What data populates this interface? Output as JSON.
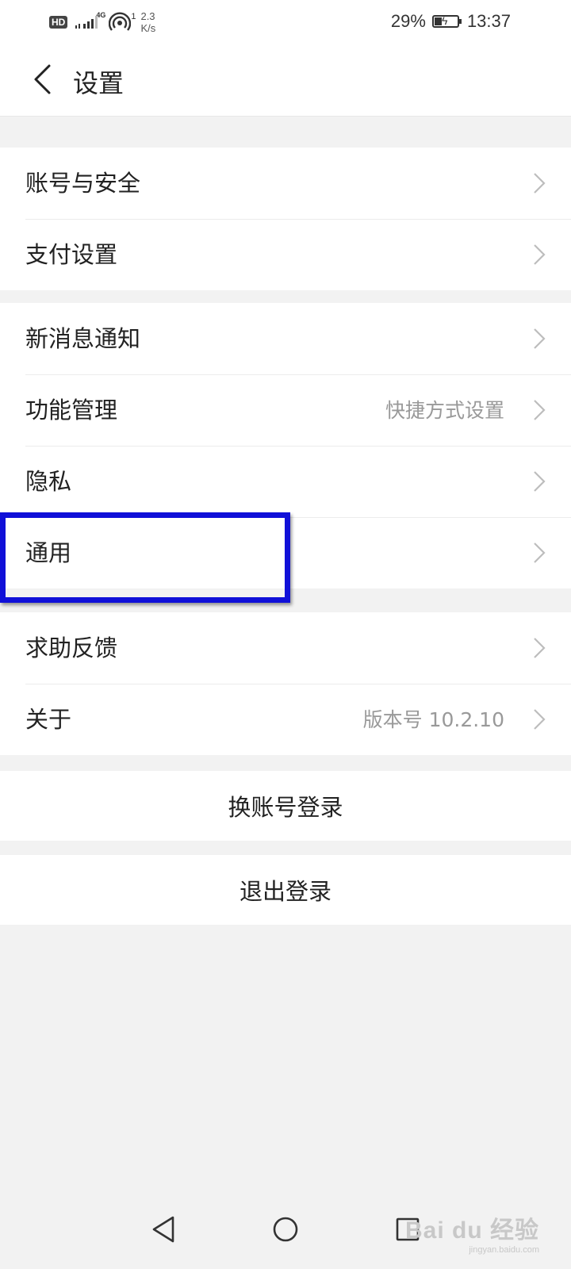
{
  "status_bar": {
    "hd": "HD",
    "network": "4G",
    "hotspot_count": "1",
    "speed_value": "2.3",
    "speed_unit": "K/s",
    "battery": "29%",
    "time": "13:37"
  },
  "header": {
    "title": "设置"
  },
  "groups": [
    {
      "items": [
        {
          "label": "账号与安全",
          "value": ""
        },
        {
          "label": "支付设置",
          "value": ""
        }
      ]
    },
    {
      "items": [
        {
          "label": "新消息通知",
          "value": ""
        },
        {
          "label": "功能管理",
          "value": "快捷方式设置"
        },
        {
          "label": "隐私",
          "value": ""
        },
        {
          "label": "通用",
          "value": ""
        }
      ]
    },
    {
      "items": [
        {
          "label": "求助反馈",
          "value": ""
        },
        {
          "label": "关于",
          "value": "版本号 10.2.10"
        }
      ]
    }
  ],
  "actions": {
    "switch_account": "换账号登录",
    "logout": "退出登录"
  },
  "watermark": {
    "main": "Bai du 经验",
    "sub": "jingyan.baidu.com"
  },
  "colors": {
    "highlight": "#1010d8",
    "background": "#f2f2f2"
  }
}
